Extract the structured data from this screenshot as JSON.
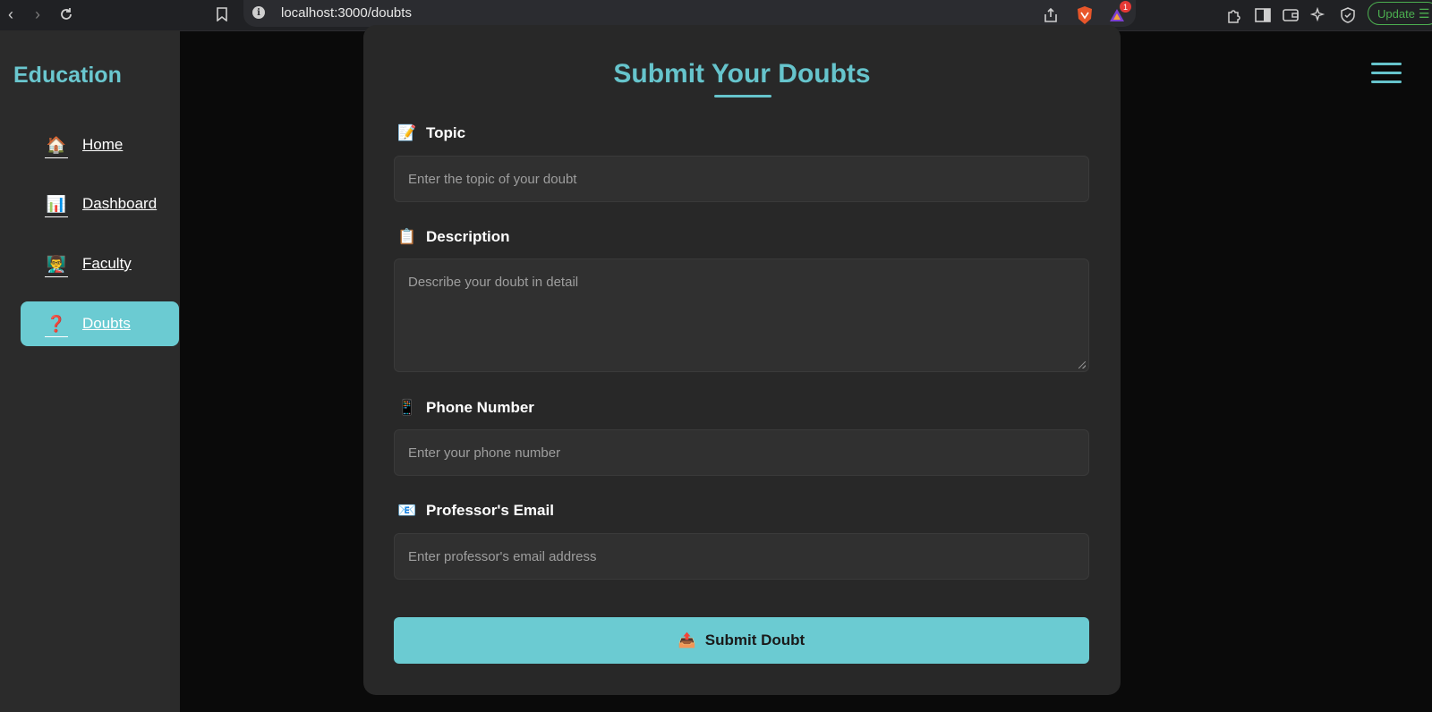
{
  "browser": {
    "url": "localhost:3000/doubts",
    "update_label": "Update",
    "notification_count": "1"
  },
  "sidebar": {
    "brand": "Education",
    "items": [
      {
        "label": "Home",
        "icon": "🏠",
        "active": false
      },
      {
        "label": "Dashboard",
        "icon": "📊",
        "active": false
      },
      {
        "label": "Faculty",
        "icon": "👨‍🏫",
        "active": false
      },
      {
        "label": "Doubts",
        "icon": "❓",
        "active": true
      }
    ]
  },
  "form": {
    "title": "Submit Your Doubts",
    "topic": {
      "label": "Topic",
      "icon": "📝",
      "placeholder": "Enter the topic of your doubt"
    },
    "description": {
      "label": "Description",
      "icon": "📋",
      "placeholder": "Describe your doubt in detail"
    },
    "phone": {
      "label": "Phone Number",
      "icon": "📱",
      "placeholder": "Enter your phone number"
    },
    "email": {
      "label": "Professor's Email",
      "icon": "📧",
      "placeholder": "Enter professor's email address"
    },
    "submit": {
      "label": "Submit Doubt",
      "icon": "📤"
    }
  },
  "colors": {
    "accent": "#66c4cc",
    "active_bg": "#6bcbd2",
    "card_bg": "#282828",
    "sidebar_bg": "#2b2b2b",
    "page_bg": "#0a0a0a"
  }
}
